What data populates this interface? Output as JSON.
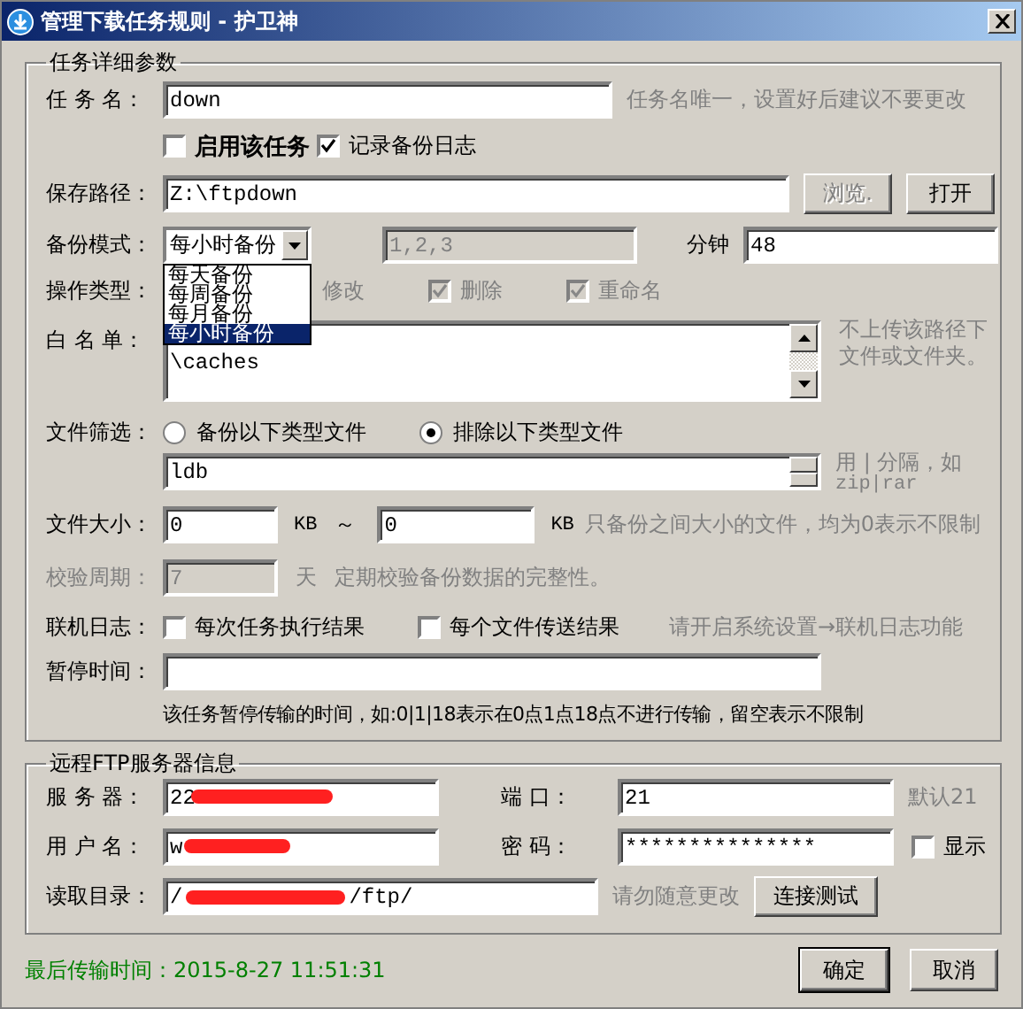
{
  "window": {
    "title": "管理下载任务规则 - 护卫神"
  },
  "task_group": {
    "legend": "任务详细参数",
    "task_name": {
      "label": "任 务 名：",
      "value": "down",
      "hint": "任务名唯一，设置好后建议不要更改"
    },
    "enable_checkbox": {
      "label": "启用该任务",
      "checked": false
    },
    "log_checkbox": {
      "label": "记录备份日志",
      "checked": true
    },
    "save_path": {
      "label": "保存路径：",
      "value": "Z:\\ftpdown",
      "browse_button": {
        "label": "浏览.",
        "disabled": true
      },
      "open_button": {
        "label": "打开",
        "disabled": false
      }
    },
    "backup_mode": {
      "label": "备份模式：",
      "value": "每小时备份",
      "expanded": true,
      "options": [
        {
          "label": "每天备份",
          "selected": false
        },
        {
          "label": "每周备份",
          "selected": false
        },
        {
          "label": "每月备份",
          "selected": false
        },
        {
          "label": "每小时备份",
          "selected": true
        }
      ],
      "days_field": {
        "value": "1,2,3",
        "disabled": true
      },
      "minute_label": "分钟",
      "minute_value": "48"
    },
    "operation_types": {
      "label": "操作类型：",
      "items": [
        {
          "label": "修改",
          "disabled": true
        },
        {
          "label": "删除",
          "checked": true,
          "disabled": true
        },
        {
          "label": "重命名",
          "checked": true,
          "disabled": true
        }
      ]
    },
    "whitelist": {
      "label": "白 名 单：",
      "lines": [
        "\\caches"
      ],
      "hint": "不上传该路径下文件或文件夹。"
    },
    "file_filter": {
      "label": "文件筛选：",
      "radios": [
        {
          "label": "备份以下类型文件",
          "selected": false
        },
        {
          "label": "排除以下类型文件",
          "selected": true
        }
      ],
      "value": "ldb",
      "hint_top": "用 | 分隔，如",
      "hint_bottom": "zip|rar"
    },
    "file_size": {
      "label": "文件大小：",
      "min": "0",
      "min_unit": "KB",
      "separator": "～",
      "max": "0",
      "max_unit": "KB",
      "hint": "只备份之间大小的文件，均为0表示不限制"
    },
    "verify_period": {
      "label": "校验周期：",
      "value": "7",
      "unit": "天",
      "hint": "定期校验备份数据的完整性。",
      "disabled": true
    },
    "online_log": {
      "label": "联机日志：",
      "items": [
        {
          "label": "每次任务执行结果",
          "checked": false
        },
        {
          "label": "每个文件传送结果",
          "checked": false
        }
      ],
      "hint": "请开启系统设置→联机日志功能"
    },
    "pause_time": {
      "label": "暂停时间：",
      "description": "该任务暂停传输的时间，如:0|1|18表示在0点1点18点不进行传输，留空表示不限制"
    }
  },
  "ftp_group": {
    "legend": "远程FTP服务器信息",
    "server": {
      "label": "服 务 器：",
      "value_start": "22",
      "redacted": true
    },
    "port": {
      "label": "端  口：",
      "value": "21",
      "hint": "默认21"
    },
    "user": {
      "label": "用 户 名：",
      "value_start": "w",
      "redacted": true
    },
    "password": {
      "label": "密  码：",
      "value": "***************"
    },
    "show_checkbox": {
      "label": "显示",
      "checked": false
    },
    "read_dir": {
      "label": "读取目录：",
      "value_start": "/",
      "value_end": "/ftp/",
      "redacted": true,
      "hint": "请勿随意更改"
    },
    "test_button": "连接测试"
  },
  "footer": {
    "last_transfer": "最后传输时间：2015-8-27 11:51:31",
    "buttons": [
      {
        "label": "确定",
        "default": true
      },
      {
        "label": "取消",
        "default": false
      }
    ]
  }
}
